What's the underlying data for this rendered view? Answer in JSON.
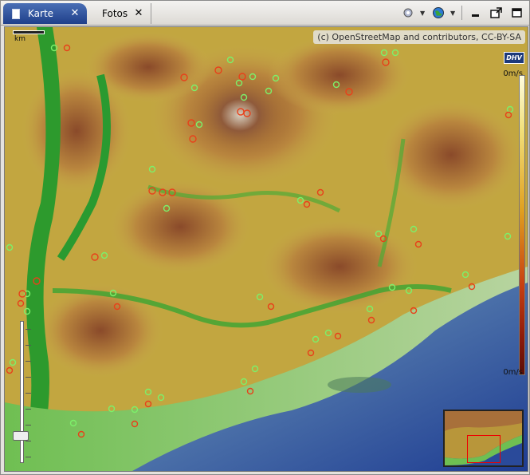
{
  "tabs": [
    {
      "label": "Karte",
      "active": true
    },
    {
      "label": "Fotos",
      "active": false
    }
  ],
  "toolbar": {
    "icons": [
      "settings-icon",
      "globe-icon",
      "minimize-icon",
      "maximize-icon",
      "restore-icon"
    ]
  },
  "map": {
    "attribution": "(c) OpenStreetMap and contributors, CC-BY-SA",
    "logo_text": "DHV",
    "scale_label": "km",
    "legend_top": "0m/s",
    "legend_bottom": "0m/s",
    "marker_colors": {
      "green": "#7cf06a",
      "red": "#e8401a"
    },
    "legend_colors": {
      "top": "#fffde0",
      "bottom": "#5a0e06"
    }
  }
}
